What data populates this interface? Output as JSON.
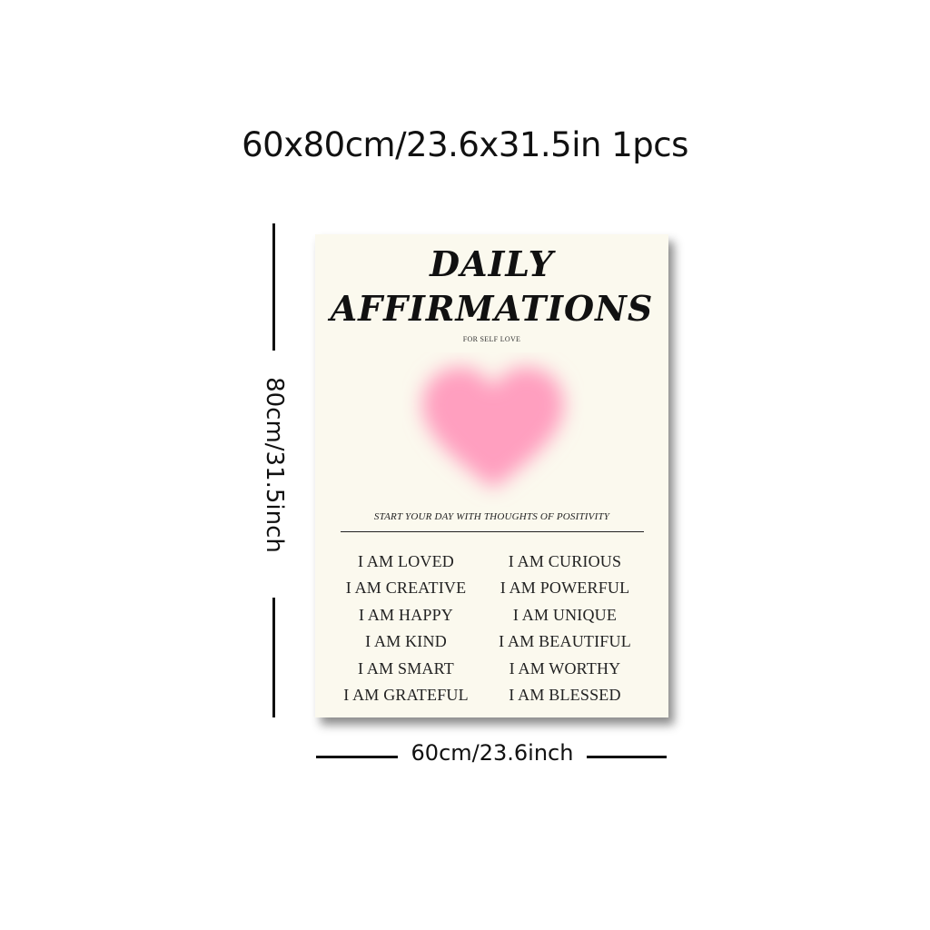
{
  "size_title": "60x80cm/23.6x31.5in 1pcs",
  "height_label": "80cm/31.5inch",
  "width_label": "60cm/23.6inch",
  "poster": {
    "title_line1": "DAILY",
    "title_line2": "AFFIRMATIONS",
    "subtitle": "FOR SELF LOVE",
    "tagline": "START YOUR DAY WITH THOUGHTS OF POSITIVITY",
    "heart_color": "#ff9fbf",
    "left_affirmations": [
      "I AM LOVED",
      "I AM CREATIVE",
      "I AM HAPPY",
      "I AM KIND",
      "I AM SMART",
      "I AM GRATEFUL"
    ],
    "right_affirmations": [
      "I AM CURIOUS",
      "I AM POWERFUL",
      "I AM UNIQUE",
      "I AM BEAUTIFUL",
      "I AM WORTHY",
      "I AM BLESSED"
    ]
  }
}
